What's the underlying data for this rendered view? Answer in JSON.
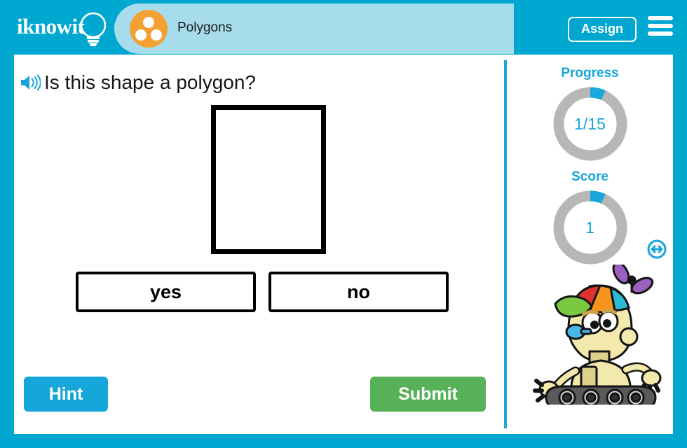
{
  "header": {
    "logo_text": "iknowit",
    "logo_icon": "lightbulb-icon",
    "topic_label": "Polygons",
    "topic_icon": "three-dots-circle-icon",
    "assign_label": "Assign",
    "menu_icon": "hamburger-menu-icon"
  },
  "question": {
    "speaker_icon": "speaker-audio-icon",
    "text": "Is this shape a polygon?",
    "shape": "rectangle"
  },
  "answers": [
    {
      "label": "yes"
    },
    {
      "label": "no"
    }
  ],
  "actions": {
    "hint_label": "Hint",
    "submit_label": "Submit"
  },
  "panel": {
    "progress": {
      "title": "Progress",
      "value": "1/15",
      "current": 1,
      "total": 15,
      "fraction": 0.0667
    },
    "score": {
      "title": "Score",
      "value": "1",
      "current": 1,
      "total": 15,
      "fraction": 0.0667
    },
    "mascot_icon": "robot-mascot-propeller-hat",
    "resize_icon": "resize-horizontal-icon"
  },
  "colors": {
    "brand_cyan": "#00a7d0",
    "accent_cyan": "#16a6d9",
    "tab_light_blue": "#a6dcec",
    "topic_orange": "#f5a032",
    "submit_green": "#56b158",
    "gauge_track_gray": "#b7b7b7",
    "shape_outline": "#000000"
  }
}
